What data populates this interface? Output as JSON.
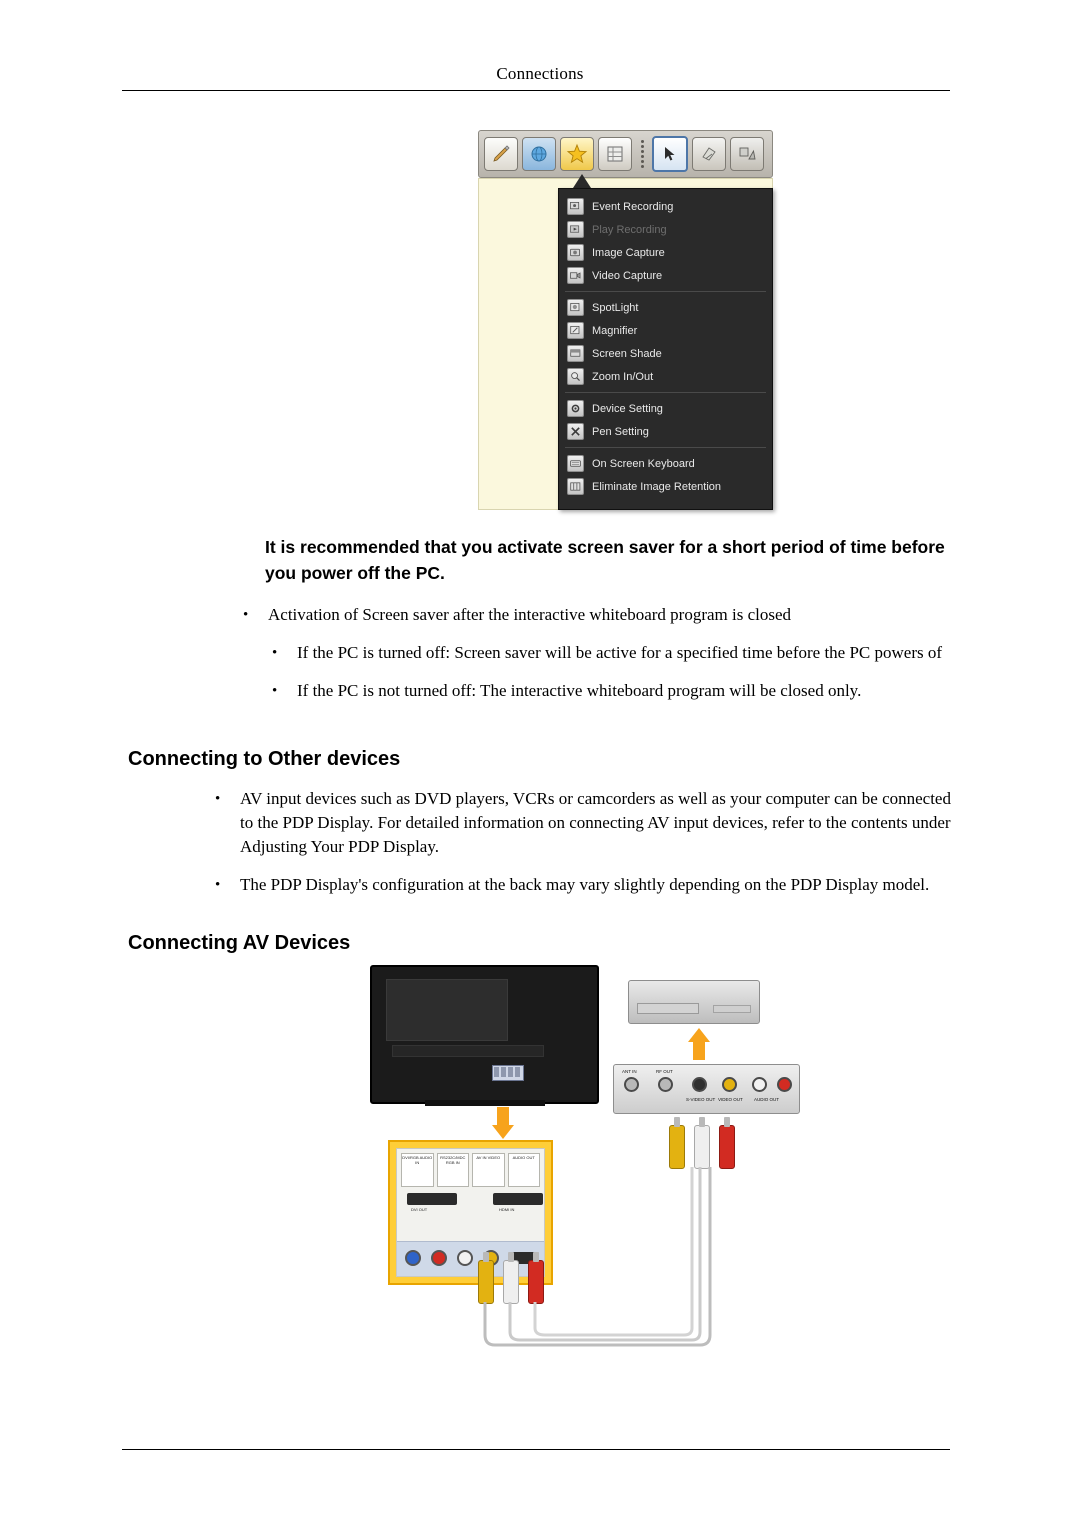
{
  "header": {
    "running_head": "Connections"
  },
  "figure1": {
    "toolbar_icons": [
      "pen-icon",
      "globe-icon",
      "star-icon",
      "grid-icon",
      "drag-dots-icon",
      "cursor-arrow-icon",
      "eraser-icon",
      "shapes-icon"
    ],
    "menu_items": [
      {
        "label": "Event Recording",
        "icon": "event-recording-icon",
        "disabled": false
      },
      {
        "label": "Play Recording",
        "icon": "play-recording-icon",
        "disabled": true
      },
      {
        "label": "Image Capture",
        "icon": "image-capture-icon",
        "disabled": false
      },
      {
        "label": "Video Capture",
        "icon": "video-capture-icon",
        "disabled": false
      },
      {
        "label": "SpotLight",
        "icon": "spotlight-icon",
        "disabled": false
      },
      {
        "label": "Magnifier",
        "icon": "magnifier-icon",
        "disabled": false
      },
      {
        "label": "Screen Shade",
        "icon": "screen-shade-icon",
        "disabled": false
      },
      {
        "label": "Zoom In/Out",
        "icon": "zoom-icon",
        "disabled": false
      },
      {
        "label": "Device Setting",
        "icon": "device-setting-icon",
        "disabled": false
      },
      {
        "label": "Pen Setting",
        "icon": "pen-setting-icon",
        "disabled": false
      },
      {
        "label": "On Screen Keyboard",
        "icon": "keyboard-icon",
        "disabled": false
      },
      {
        "label": "Eliminate Image Retention",
        "icon": "eliminate-retention-icon",
        "disabled": false
      }
    ]
  },
  "note": {
    "text": "It is recommended that you activate screen saver for a short period of time before you power off the PC."
  },
  "note_bullets": [
    "Activation of Screen saver after the interactive whiteboard program is closed",
    "If the PC is turned off: Screen saver will be active for a specified time before the PC powers of",
    "If the PC is not turned off: The interactive whiteboard program will be closed only."
  ],
  "sections": [
    {
      "id": "other-devices",
      "heading": "Connecting to Other devices"
    },
    {
      "id": "av-devices",
      "heading": "Connecting AV Devices"
    }
  ],
  "other_device_bullets": [
    "AV input devices such as DVD players, VCRs or camcorders as well as your computer can be connected to the PDP Display. For detailed information on connecting AV input devices, refer to the contents under Adjusting Your PDP Display.",
    "The PDP Display's configuration at the back may vary slightly depending on the PDP Display model."
  ],
  "figure2": {
    "display_panel_labels": [
      "DVI/RGB AUDIO IN",
      "RS232C/MDC RGB IN",
      "AV IN VIDEO",
      "AUDIO OUT",
      "HDMI IN",
      "DVI OUT"
    ],
    "source_device_labels": [
      "ANT IN",
      "RF OUT",
      "S-VIDEO OUT",
      "VIDEO OUT",
      "AUDIO OUT"
    ],
    "cable_colors": {
      "video": "#e3b211",
      "audio_left": "#f2f2f2",
      "audio_right": "#d22b22"
    }
  },
  "bullet_marker": "•"
}
